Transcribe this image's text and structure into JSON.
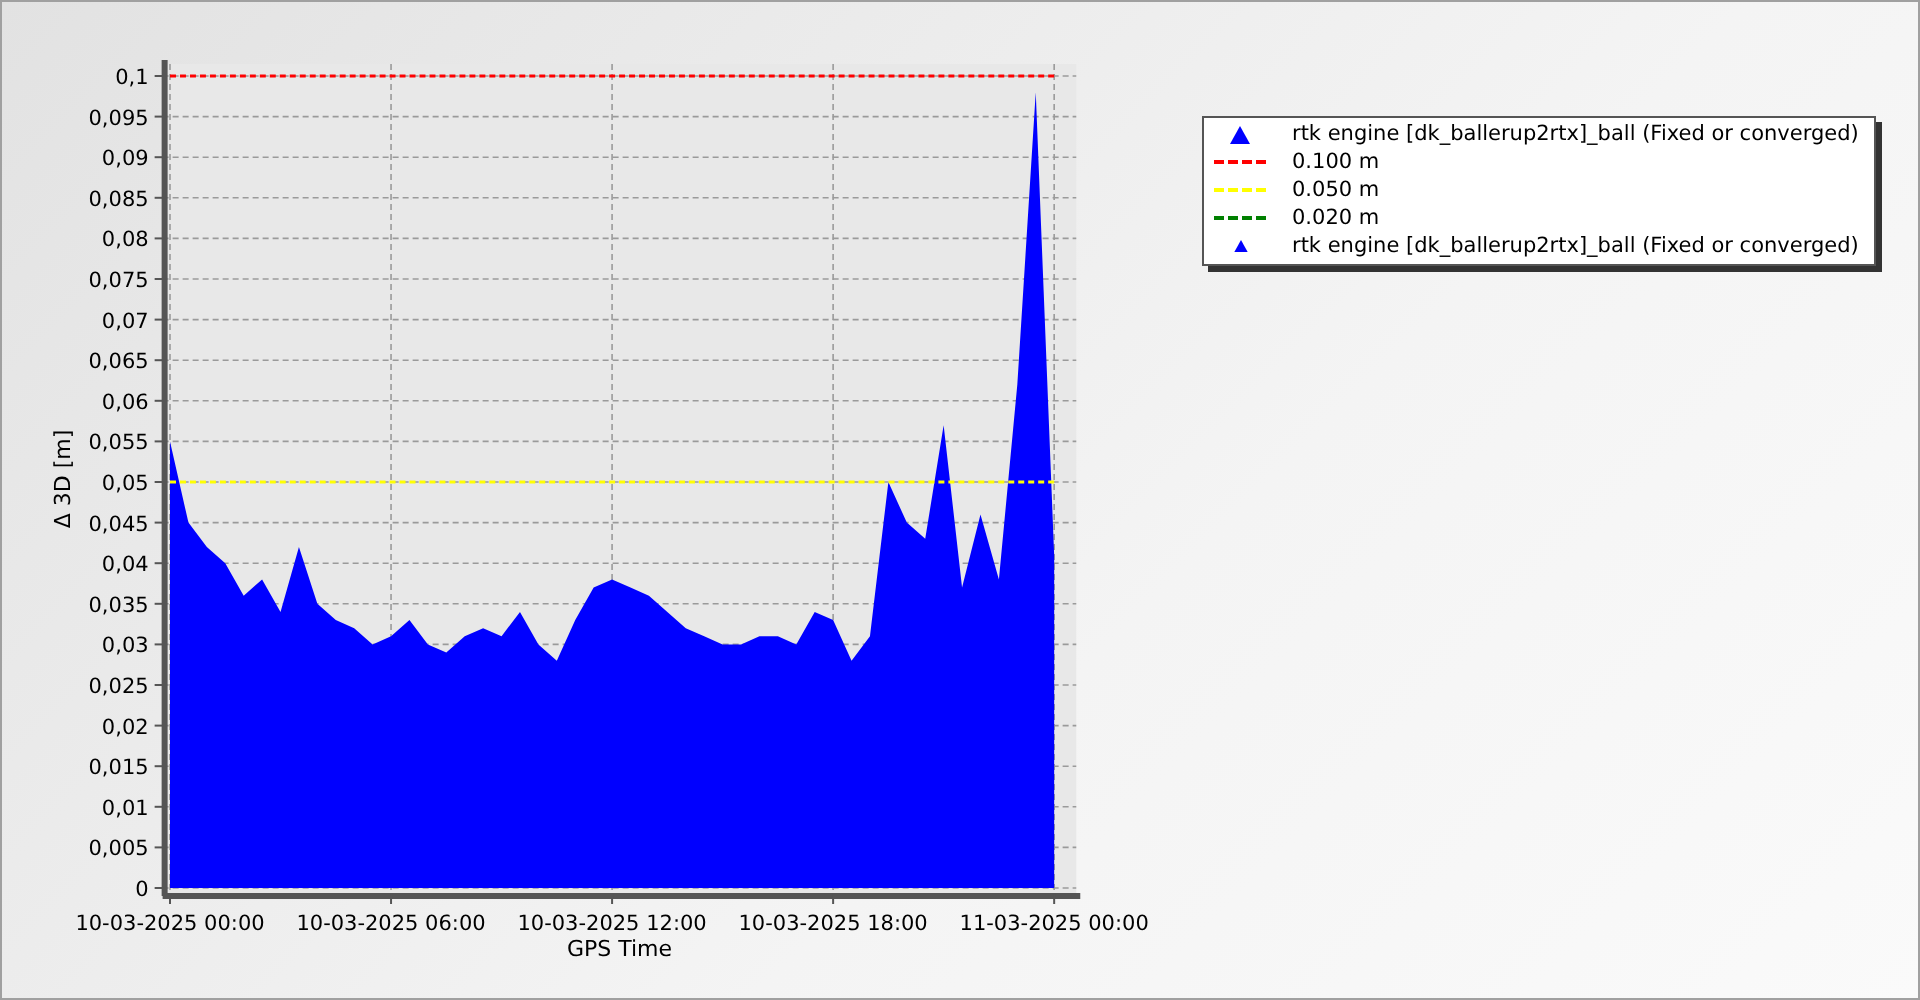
{
  "chart": {
    "chart_data": {
      "type": "area",
      "grid": true,
      "xlabel": "GPS Time",
      "ylabel": "Δ 3D [m]",
      "ylim": [
        0,
        0.1
      ],
      "yticks": [
        {
          "value": 0,
          "label": "0"
        },
        {
          "value": 0.005,
          "label": "0,005"
        },
        {
          "value": 0.01,
          "label": "0,01"
        },
        {
          "value": 0.015,
          "label": "0,015"
        },
        {
          "value": 0.02,
          "label": "0,02"
        },
        {
          "value": 0.025,
          "label": "0,025"
        },
        {
          "value": 0.03,
          "label": "0,03"
        },
        {
          "value": 0.035,
          "label": "0,035"
        },
        {
          "value": 0.04,
          "label": "0,04"
        },
        {
          "value": 0.045,
          "label": "0,045"
        },
        {
          "value": 0.05,
          "label": "0,05"
        },
        {
          "value": 0.055,
          "label": "0,055"
        },
        {
          "value": 0.06,
          "label": "0,06"
        },
        {
          "value": 0.065,
          "label": "0,065"
        },
        {
          "value": 0.07,
          "label": "0,07"
        },
        {
          "value": 0.075,
          "label": "0,075"
        },
        {
          "value": 0.08,
          "label": "0,08"
        },
        {
          "value": 0.085,
          "label": "0,085"
        },
        {
          "value": 0.09,
          "label": "0,09"
        },
        {
          "value": 0.095,
          "label": "0,095"
        },
        {
          "value": 0.1,
          "label": "0,1"
        }
      ],
      "categories": [
        "10-03-2025 00:00",
        null,
        null,
        null,
        null,
        null,
        null,
        null,
        null,
        null,
        null,
        null,
        "10-03-2025 06:00",
        null,
        null,
        null,
        null,
        null,
        null,
        null,
        null,
        null,
        null,
        null,
        "10-03-2025 12:00",
        null,
        null,
        null,
        null,
        null,
        null,
        null,
        null,
        null,
        null,
        null,
        "10-03-2025 18:00",
        null,
        null,
        null,
        null,
        null,
        null,
        null,
        null,
        null,
        null,
        null,
        "11-03-2025 00:00"
      ],
      "series": [
        {
          "type": "area",
          "color": "#0000ff",
          "values": [
            0.055,
            0.045,
            0.042,
            0.04,
            0.036,
            0.038,
            0.034,
            0.042,
            0.035,
            0.033,
            0.032,
            0.03,
            0.031,
            0.033,
            0.03,
            0.029,
            0.031,
            0.032,
            0.031,
            0.034,
            0.03,
            0.028,
            0.033,
            0.037,
            0.038,
            0.037,
            0.036,
            0.034,
            0.032,
            0.031,
            0.03,
            0.03,
            0.031,
            0.031,
            0.03,
            0.034,
            0.033,
            0.028,
            0.031,
            0.05,
            0.045,
            0.043,
            0.057,
            0.037,
            0.046,
            0.038,
            0.062,
            0.098,
            0.041
          ]
        },
        {
          "type": "line",
          "line_style": "dashed",
          "color": "#ff0000",
          "values": [
            0.1,
            0.1,
            0.1,
            0.1,
            0.1,
            0.1,
            0.1,
            0.1,
            0.1,
            0.1,
            0.1,
            0.1,
            0.1,
            0.1,
            0.1,
            0.1,
            0.1,
            0.1,
            0.1,
            0.1,
            0.1,
            0.1,
            0.1,
            0.1,
            0.1,
            0.1,
            0.1,
            0.1,
            0.1,
            0.1,
            0.1,
            0.1,
            0.1,
            0.1,
            0.1,
            0.1,
            0.1,
            0.1,
            0.1,
            0.1,
            0.1,
            0.1,
            0.1,
            0.1,
            0.1,
            0.1,
            0.1,
            0.1,
            0.1
          ]
        },
        {
          "type": "line",
          "line_style": "dashed",
          "color": "#ffff00",
          "values": [
            0.05,
            0.05,
            0.05,
            0.05,
            0.05,
            0.05,
            0.05,
            0.05,
            0.05,
            0.05,
            0.05,
            0.05,
            0.05,
            0.05,
            0.05,
            0.05,
            0.05,
            0.05,
            0.05,
            0.05,
            0.05,
            0.05,
            0.05,
            0.05,
            0.05,
            0.05,
            0.05,
            0.05,
            0.05,
            0.05,
            0.05,
            0.05,
            0.05,
            0.05,
            0.05,
            0.05,
            0.05,
            0.05,
            0.05,
            0.05,
            0.05,
            0.05,
            0.05,
            0.05,
            0.05,
            0.05,
            0.05,
            0.05,
            0.05
          ]
        }
      ]
    }
  },
  "legend": {
    "items": [
      {
        "kind": "large-marker",
        "color": "#0000ff",
        "label": "rtk engine [dk_ballerup2rtx]_ball (Fixed or converged)"
      },
      {
        "kind": "dash",
        "color": "#ff0000",
        "label": "0.100 m"
      },
      {
        "kind": "dash",
        "color": "#ffff00",
        "label": "0.050 m"
      },
      {
        "kind": "dash",
        "color": "#008000",
        "label": "0.020 m"
      },
      {
        "kind": "small-marker",
        "color": "#0000ff",
        "label": "rtk engine [dk_ballerup2rtx]_ball (Fixed or converged)"
      }
    ]
  }
}
